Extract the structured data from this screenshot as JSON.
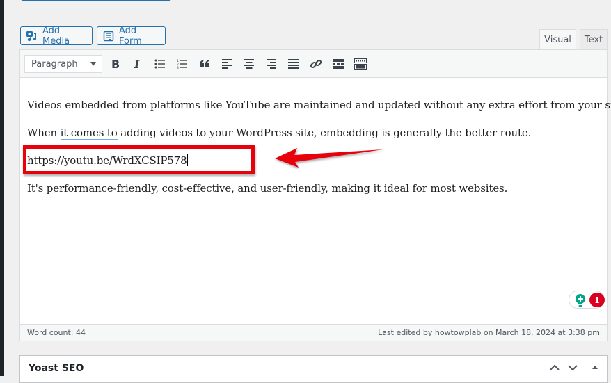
{
  "media_buttons": {
    "add_media": "Add Media",
    "add_form": "Add Form"
  },
  "editor_tabs": {
    "visual": "Visual",
    "text": "Text",
    "active": "Visual"
  },
  "toolbar": {
    "format_select": "Paragraph",
    "buttons": [
      {
        "name": "bold",
        "icon": "bold-icon"
      },
      {
        "name": "italic",
        "icon": "italic-icon"
      },
      {
        "name": "bulleted-list",
        "icon": "bulleted-list-icon"
      },
      {
        "name": "numbered-list",
        "icon": "numbered-list-icon"
      },
      {
        "name": "blockquote",
        "icon": "blockquote-icon"
      },
      {
        "name": "align-left",
        "icon": "align-left-icon"
      },
      {
        "name": "align-center",
        "icon": "align-center-icon"
      },
      {
        "name": "align-right",
        "icon": "align-right-icon"
      },
      {
        "name": "justify",
        "icon": "justify-icon"
      },
      {
        "name": "insert-link",
        "icon": "link-icon"
      },
      {
        "name": "read-more",
        "icon": "read-more-icon"
      },
      {
        "name": "toolbar-toggle",
        "icon": "keyboard-icon"
      }
    ]
  },
  "content": {
    "p1": "Videos embedded from platforms like YouTube are maintained and updated without any extra effort from your side.",
    "p2_before": "When ",
    "p2_spell": "it comes to",
    "p2_after": " adding videos to your WordPress site, embedding is generally the better route.",
    "p3_url": "https://youtu.be/WrdXCSIP578",
    "p4": "It's performance-friendly, cost-effective, and user-friendly, making it ideal for most websites."
  },
  "annotation": {
    "highlight_color": "#e8000b"
  },
  "yoast_badge": {
    "count": "1",
    "bulb_color": "#00a58a",
    "badge_color": "#dc0020"
  },
  "statusbar": {
    "word_count": "Word count: 44",
    "last_edited": "Last edited by howtowplab on March 18, 2024 at 3:38 pm"
  },
  "yoast_panel": {
    "title": "Yoast SEO"
  }
}
